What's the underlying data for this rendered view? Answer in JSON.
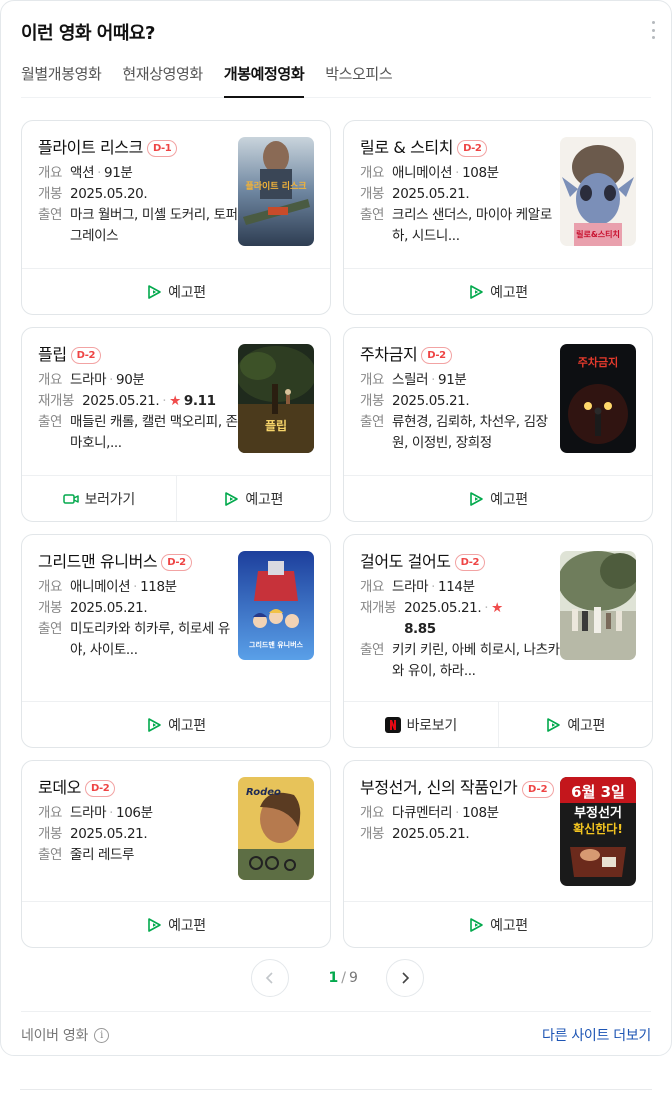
{
  "header": {
    "title": "이런 영화 어때요?"
  },
  "tabs": [
    {
      "label": "월별개봉영화",
      "active": false
    },
    {
      "label": "현재상영영화",
      "active": false
    },
    {
      "label": "개봉예정영화",
      "active": true
    },
    {
      "label": "박스오피스",
      "active": false
    }
  ],
  "labels": {
    "summary": "개요",
    "release": "개봉",
    "rerelease": "재개봉",
    "cast": "출연",
    "dot": "·",
    "star": "★"
  },
  "movies": [
    {
      "title": "플라이트 리스크",
      "dday": "D-1",
      "genre": "액션",
      "runtime": "91분",
      "release_label": "개봉",
      "date": "2025.05.20.",
      "cast": "마크 월버그, 미셸 도커리, 토퍼 그레이스",
      "buttons": [
        {
          "label": "예고편",
          "icon": "play-icon"
        }
      ]
    },
    {
      "title": "릴로 & 스티치",
      "dday": "D-2",
      "genre": "애니메이션",
      "runtime": "108분",
      "release_label": "개봉",
      "date": "2025.05.21.",
      "cast": "크리스 샌더스, 마이아 케알로하, 시드니...",
      "buttons": [
        {
          "label": "예고편",
          "icon": "play-icon"
        }
      ]
    },
    {
      "title": "플립",
      "dday": "D-2",
      "genre": "드라마",
      "runtime": "90분",
      "release_label": "재개봉",
      "date": "2025.05.21.",
      "rating": "9.11",
      "cast": "매들린 캐롤, 캘런 맥오리피, 존 마호니,...",
      "buttons": [
        {
          "label": "보러가기",
          "icon": "video-icon"
        },
        {
          "label": "예고편",
          "icon": "play-icon"
        }
      ]
    },
    {
      "title": "주차금지",
      "dday": "D-2",
      "genre": "스릴러",
      "runtime": "91분",
      "release_label": "개봉",
      "date": "2025.05.21.",
      "cast": "류현경, 김뢰하, 차선우, 김장원, 이정빈, 장희정",
      "buttons": [
        {
          "label": "예고편",
          "icon": "play-icon"
        }
      ]
    },
    {
      "title": "그리드맨 유니버스",
      "dday": "D-2",
      "genre": "애니메이션",
      "runtime": "118분",
      "release_label": "개봉",
      "date": "2025.05.21.",
      "cast": "미도리카와 히카루, 히로세 유야, 사이토...",
      "buttons": [
        {
          "label": "예고편",
          "icon": "play-icon"
        }
      ]
    },
    {
      "title": "걸어도 걸어도",
      "dday": "D-2",
      "genre": "드라마",
      "runtime": "114분",
      "release_label": "재개봉",
      "date": "2025.05.21.",
      "rating": "8.85",
      "cast": "키키 키린, 아베 히로시, 나츠카와 유이, 하라...",
      "buttons": [
        {
          "label": "바로보기",
          "icon": "netflix-icon"
        },
        {
          "label": "예고편",
          "icon": "play-icon"
        }
      ]
    },
    {
      "title": "로데오",
      "dday": "D-2",
      "genre": "드라마",
      "runtime": "106분",
      "release_label": "개봉",
      "date": "2025.05.21.",
      "cast": "줄리 레드루",
      "buttons": [
        {
          "label": "예고편",
          "icon": "play-icon"
        }
      ]
    },
    {
      "title": "부정선거, 신의 작품인가",
      "dday": "D-2",
      "genre": "다큐멘터리",
      "runtime": "108분",
      "release_label": "개봉",
      "date": "2025.05.21.",
      "cast": "",
      "buttons": [
        {
          "label": "예고편",
          "icon": "play-icon"
        }
      ]
    }
  ],
  "posters": {
    "p0": {
      "text": "플라이트 리스크"
    },
    "p1": {
      "text": "릴로&스티치"
    },
    "p2": {
      "text": "플립"
    },
    "p3": {
      "text": "주차금지"
    },
    "p4": {
      "text": "그리드맨 유니버스"
    },
    "p6": {
      "text": "Rodeo"
    },
    "p7": {
      "line1": "6월 3일",
      "line2": "부정선거",
      "line3": "확신한다!"
    }
  },
  "pagination": {
    "current": "1",
    "sep": "/",
    "total": "9"
  },
  "footer": {
    "source": "네이버 영화",
    "info": "i",
    "more_link": "다른 사이트 더보기"
  },
  "colors": {
    "accent_green": "#03a94d",
    "dday_red": "#e44",
    "link_blue": "#1e55b4",
    "star_red": "#f04c4c"
  }
}
